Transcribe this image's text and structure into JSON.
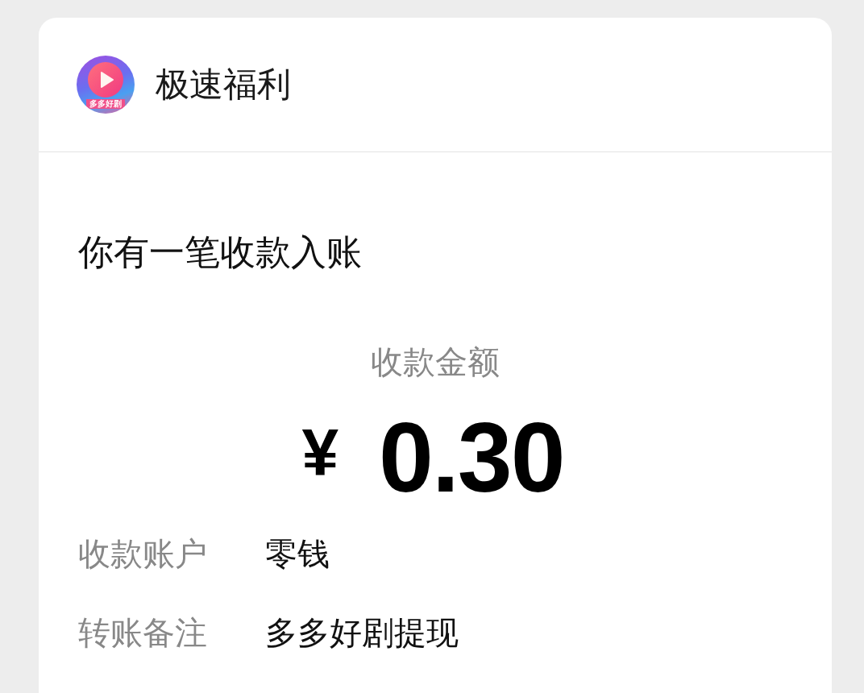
{
  "header": {
    "app_name": "极速福利",
    "logo_text": "多多好剧"
  },
  "message": {
    "title": "你有一笔收款入账",
    "amount_label": "收款金额",
    "currency": "¥",
    "amount": "0.30"
  },
  "details": [
    {
      "label": "收款账户",
      "value": "零钱"
    },
    {
      "label": "转账备注",
      "value": "多多好剧提现"
    }
  ]
}
